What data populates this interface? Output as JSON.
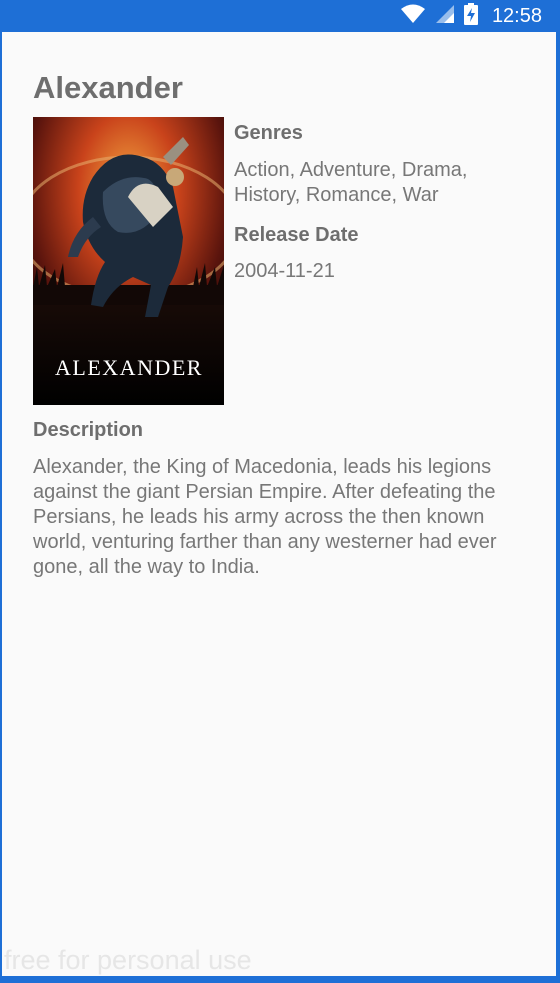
{
  "status_bar": {
    "time": "12:58",
    "icons": [
      "wifi-icon",
      "signal-icon",
      "battery-charging-icon"
    ]
  },
  "movie": {
    "title": "Alexander",
    "poster_text": "ALEXANDER",
    "genres_label": "Genres",
    "genres": "Action, Adventure, Drama, History, Romance, War",
    "release_label": "Release Date",
    "release_date": "2004-11-21",
    "description_label": "Description",
    "description": "Alexander, the King of Macedonia, leads his legions against the giant Persian Empire. After defeating the Persians, he leads his army across the then known world, venturing farther than any westerner had ever gone, all the way to India."
  },
  "watermark": "free for personal use",
  "colors": {
    "status_bar": "#1e6fd6",
    "background": "#fafafa",
    "text": "#777777"
  }
}
